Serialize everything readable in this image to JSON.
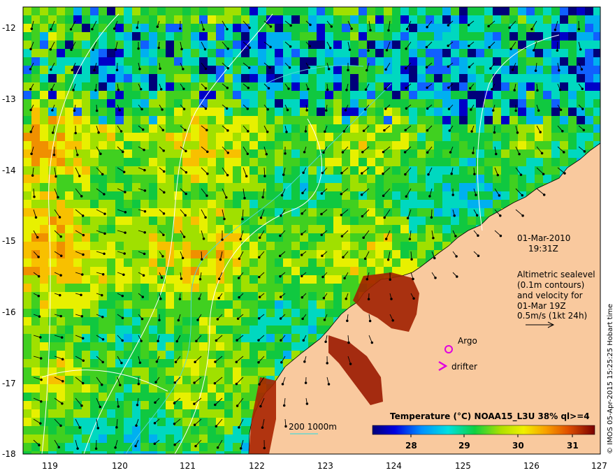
{
  "map": {
    "lat_labels": [
      "-12",
      "-13",
      "-14",
      "-15",
      "-16",
      "-17",
      "-18"
    ],
    "lon_labels": [
      "119",
      "120",
      "121",
      "122",
      "123",
      "124",
      "125",
      "126",
      "127"
    ],
    "date": "01-Mar-2010",
    "time": "19:31Z",
    "altimetry_lines": [
      "Altimetric sealevel",
      "(0.1m contours)",
      "and velocity for",
      "01-Mar 19Z",
      "0.5m/s (1kt 24h)"
    ],
    "argo_label": "Argo",
    "drifter_label": "drifter",
    "depth_label": "200  1000m",
    "colorbar_title": "Temperature (°C) NOAA15_L3U 38% ql>=4",
    "colorbar_ticks": [
      "28",
      "29",
      "30",
      "31"
    ],
    "credit": "© IMOS 05-Apr-2015 15:25:25 Hobart time",
    "colors": {
      "land": "#f9c99e",
      "argo": "#e000e0",
      "drifter": "#e000e0",
      "isobath": "#4fd8d8",
      "contour": "#ffffff"
    }
  }
}
